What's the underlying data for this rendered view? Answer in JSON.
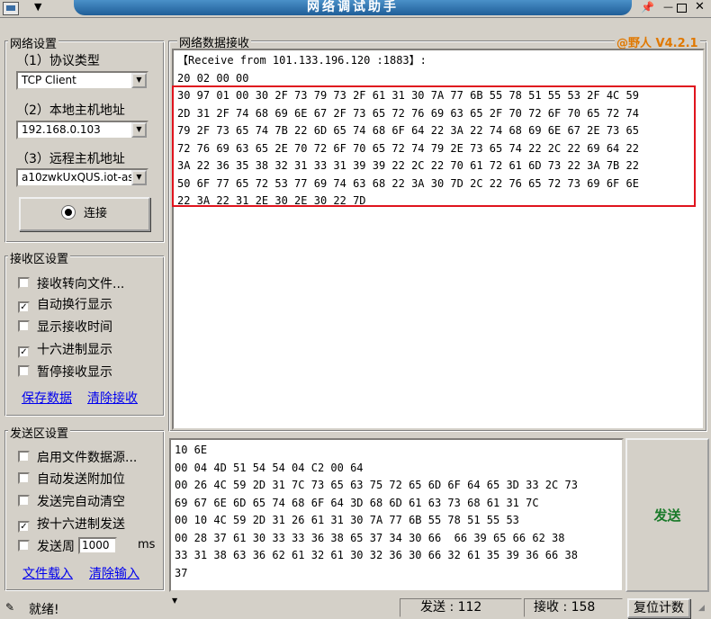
{
  "window": {
    "title": "网络调试助手"
  },
  "network_settings": {
    "legend": "网络设置",
    "protocol_label": "（1）协议类型",
    "protocol_value": "TCP Client",
    "local_host_label": "（2）本地主机地址",
    "local_host_value": "192.168.0.103",
    "remote_host_label": "（3）远程主机地址",
    "remote_host_value": "a10zwkUxQUS.iot-as",
    "connect_label": "连接"
  },
  "receive_settings": {
    "legend": "接收区设置",
    "options": [
      {
        "label": "接收转向文件...",
        "checked": false
      },
      {
        "label": "自动换行显示",
        "checked": true
      },
      {
        "label": "显示接收时间",
        "checked": false
      },
      {
        "label": "十六进制显示",
        "checked": true
      },
      {
        "label": "暂停接收显示",
        "checked": false
      }
    ],
    "save_link": "保存数据",
    "clear_link": "清除接收"
  },
  "send_settings": {
    "legend": "发送区设置",
    "options": [
      {
        "label": "启用文件数据源...",
        "checked": false
      },
      {
        "label": "自动发送附加位",
        "checked": false
      },
      {
        "label": "发送完自动清空",
        "checked": false
      },
      {
        "label": "按十六进制发送",
        "checked": true
      }
    ],
    "period_label": "发送周",
    "period_value": "1000",
    "period_unit": "ms",
    "load_link": "文件载入",
    "clear_link": "清除输入"
  },
  "receive_area": {
    "legend": "网络数据接收",
    "version": "@野人 V4.2.1",
    "lines": [
      "【Receive from 101.133.196.120 :1883】:",
      "20 02 00 00",
      "30 97 01 00 30 2F 73 79 73 2F 61 31 30 7A 77 6B 55 78 51 55 53 2F 4C 59",
      "2D 31 2F 74 68 69 6E 67 2F 73 65 72 76 69 63 65 2F 70 72 6F 70 65 72 74",
      "79 2F 73 65 74 7B 22 6D 65 74 68 6F 64 22 3A 22 74 68 69 6E 67 2E 73 65",
      "72 76 69 63 65 2E 70 72 6F 70 65 72 74 79 2E 73 65 74 22 2C 22 69 64 22",
      "3A 22 36 35 38 32 31 33 31 39 39 22 2C 22 70 61 72 61 6D 73 22 3A 7B 22",
      "50 6F 77 65 72 53 77 69 74 63 68 22 3A 30 7D 2C 22 76 65 72 73 69 6F 6E",
      "22 3A 22 31 2E 30 2E 30 22 7D"
    ]
  },
  "send_area": {
    "lines": [
      "10 6E",
      "00 04 4D 51 54 54 04 C2 00 64",
      "00 26 4C 59 2D 31 7C 73 65 63 75 72 65 6D 6F 64 65 3D 33 2C 73",
      "69 67 6E 6D 65 74 68 6F 64 3D 68 6D 61 63 73 68 61 31 7C",
      "00 10 4C 59 2D 31 26 61 31 30 7A 77 6B 55 78 51 55 53",
      "00 28 37 61 30 33 33 36 38 65 37 34 30 66  66 39 65 66 62 38",
      "33 31 38 63 36 62 61 32 61 30 32 36 30 66 32 61 35 39 36 66 38",
      "37"
    ],
    "send_button": "发送"
  },
  "status_bar": {
    "ready_text": "就绪!",
    "sent_label": "发送 : 112",
    "received_label": "接收 : 158",
    "reset_button": "复位计数"
  },
  "colors": {
    "title_bar": "#1f5e98",
    "highlight_box": "#e0141e",
    "send_button_text": "#1a7a2a",
    "version_text": "#e07800"
  }
}
